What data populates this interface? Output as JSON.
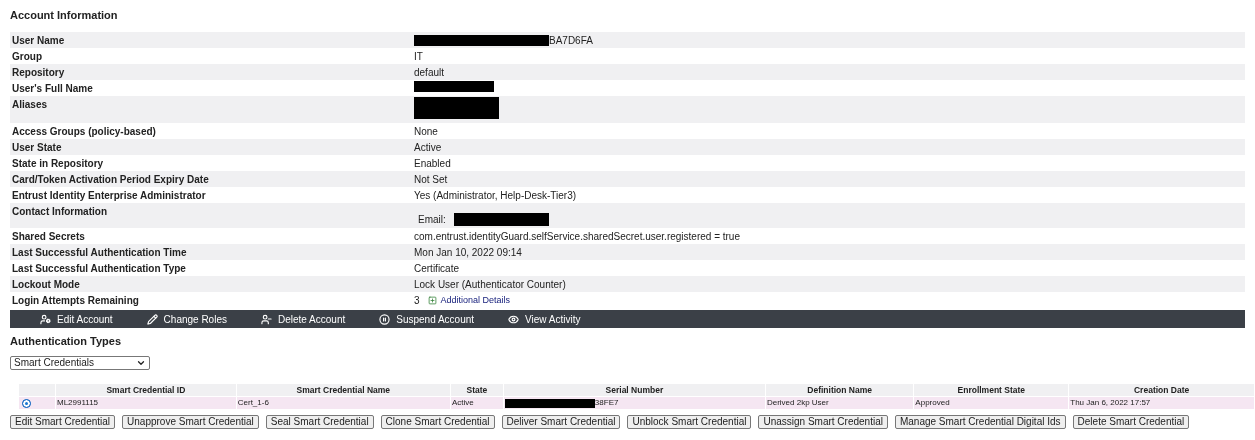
{
  "title": "Account Information",
  "fields": [
    {
      "label": "User Name",
      "kind": "redacted_prefix",
      "value": "BA7D6FA"
    },
    {
      "label": "Group",
      "kind": "text",
      "value": "IT"
    },
    {
      "label": "Repository",
      "kind": "text",
      "value": "default"
    },
    {
      "label": "User's Full Name",
      "kind": "redacted"
    },
    {
      "label": "Aliases",
      "kind": "redacted_tall"
    },
    {
      "label": "Access Groups (policy-based)",
      "kind": "text",
      "value": "None"
    },
    {
      "label": "User State",
      "kind": "text",
      "value": "Active"
    },
    {
      "label": "State in Repository",
      "kind": "text",
      "value": "Enabled"
    },
    {
      "label": "Card/Token Activation Period Expiry Date",
      "kind": "text",
      "value": "Not Set"
    },
    {
      "label": "Entrust Identity Enterprise Administrator",
      "kind": "text",
      "value": "Yes (Administrator, Help-Desk-Tier3)"
    },
    {
      "label": "Contact Information",
      "kind": "email",
      "value": "Email:"
    },
    {
      "label": "Shared Secrets",
      "kind": "text",
      "value": "com.entrust.identityGuard.selfService.sharedSecret.user.registered = true"
    },
    {
      "label": "Last Successful Authentication Time",
      "kind": "text",
      "value": "Mon Jan 10, 2022 09:14"
    },
    {
      "label": "Last Successful Authentication Type",
      "kind": "text",
      "value": "Certificate"
    },
    {
      "label": "Lockout Mode",
      "kind": "text",
      "value": "Lock User (Authenticator Counter)"
    },
    {
      "label": "Login Attempts Remaining",
      "kind": "details",
      "value": "3",
      "link": "Additional Details"
    }
  ],
  "toolbar": [
    {
      "kind": "user-cog",
      "label": "Edit Account"
    },
    {
      "kind": "pencil",
      "label": "Change Roles"
    },
    {
      "kind": "user-minus",
      "label": "Delete Account"
    },
    {
      "kind": "pause",
      "label": "Suspend Account"
    },
    {
      "kind": "eye",
      "label": "View Activity"
    }
  ],
  "auth_title": "Authentication Types",
  "auth_select": {
    "value": "Smart Credentials"
  },
  "table": {
    "columns": [
      "Smart Credential ID",
      "Smart Credential Name",
      "State",
      "Serial Number",
      "Definition Name",
      "Enrollment State",
      "Creation Date"
    ],
    "rows": [
      {
        "selected": true,
        "cells": [
          "ML2991115",
          "Cert_1-6",
          "Active",
          "38FE7",
          "Derived 2kp User",
          "Approved",
          "Thu Jan 6, 2022 17:57"
        ]
      }
    ]
  },
  "buttons": [
    "Edit Smart Credential",
    "Unapprove Smart Credential",
    "Seal Smart Credential",
    "Clone Smart Credential",
    "Deliver Smart Credential",
    "Unblock Smart Credential",
    "Unassign Smart Credential",
    "Manage Smart Credential Digital Ids",
    "Delete Smart Credential"
  ]
}
